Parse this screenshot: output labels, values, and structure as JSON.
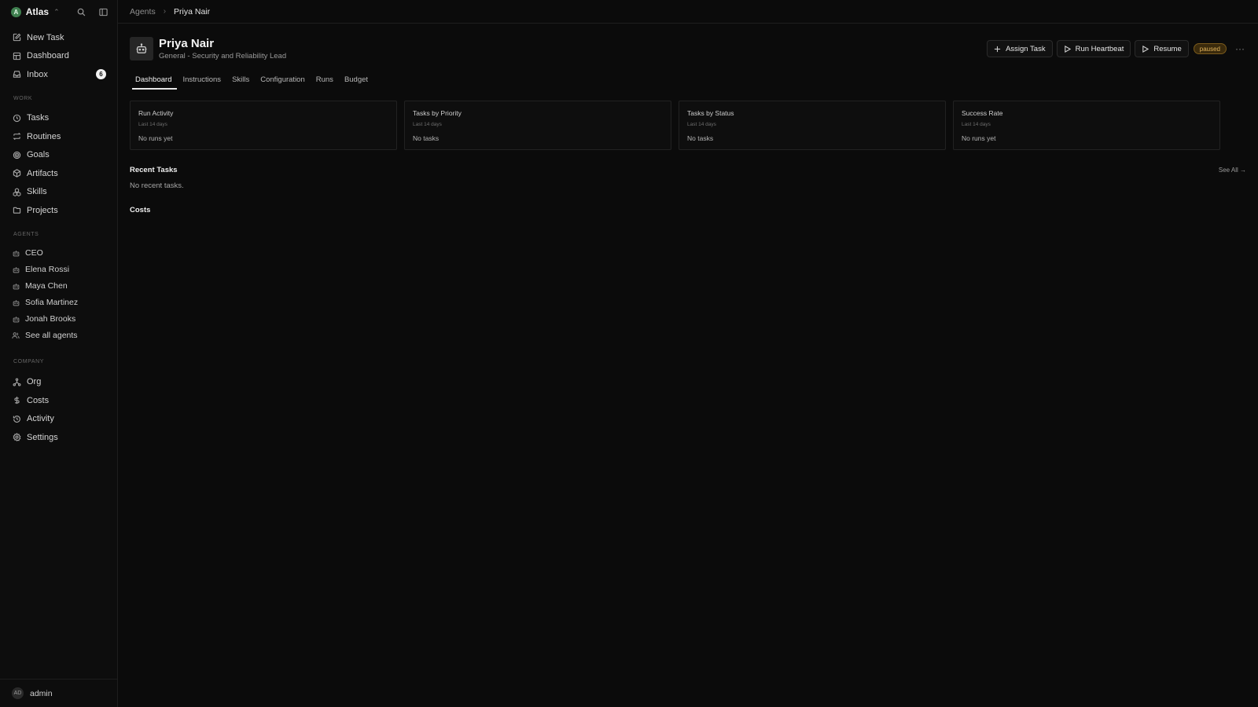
{
  "workspace": {
    "logo_letter": "A",
    "name": "Atlas"
  },
  "sidebar": {
    "primary": [
      {
        "label": "New Task",
        "icon": "pencil-square-icon"
      },
      {
        "label": "Dashboard",
        "icon": "dashboard-icon"
      },
      {
        "label": "Inbox",
        "icon": "inbox-icon",
        "badge": "6"
      }
    ],
    "work_label": "WORK",
    "work": [
      {
        "label": "Tasks",
        "icon": "circle-check-icon"
      },
      {
        "label": "Routines",
        "icon": "repeat-icon"
      },
      {
        "label": "Goals",
        "icon": "target-icon"
      },
      {
        "label": "Artifacts",
        "icon": "box-icon"
      },
      {
        "label": "Skills",
        "icon": "boxes-icon"
      },
      {
        "label": "Projects",
        "icon": "folder-icon"
      }
    ],
    "agents_label": "AGENTS",
    "agents": [
      "CEO",
      "Elena Rossi",
      "Maya Chen",
      "Sofia Martinez",
      "Jonah Brooks"
    ],
    "see_all_agents": "See all agents",
    "company_label": "COMPANY",
    "company": [
      {
        "label": "Org",
        "icon": "org-icon"
      },
      {
        "label": "Costs",
        "icon": "dollar-icon"
      },
      {
        "label": "Activity",
        "icon": "history-icon"
      },
      {
        "label": "Settings",
        "icon": "gear-icon"
      }
    ],
    "footer": {
      "initials": "AD",
      "name": "admin"
    }
  },
  "breadcrumb": {
    "parent": "Agents",
    "current": "Priya Nair"
  },
  "agent": {
    "name": "Priya Nair",
    "subtitle": "General - Security and Reliability Lead",
    "status": "paused"
  },
  "actions": {
    "assign": "Assign Task",
    "heartbeat": "Run Heartbeat",
    "resume": "Resume",
    "more": "···"
  },
  "tabs": [
    "Dashboard",
    "Instructions",
    "Skills",
    "Configuration",
    "Runs",
    "Budget"
  ],
  "cards": [
    {
      "title": "Run Activity",
      "sub": "Last 14 days",
      "empty": "No runs yet"
    },
    {
      "title": "Tasks by Priority",
      "sub": "Last 14 days",
      "empty": "No tasks"
    },
    {
      "title": "Tasks by Status",
      "sub": "Last 14 days",
      "empty": "No tasks"
    },
    {
      "title": "Success Rate",
      "sub": "Last 14 days",
      "empty": "No runs yet"
    }
  ],
  "recent": {
    "title": "Recent Tasks",
    "see_all": "See All →",
    "empty": "No recent tasks."
  },
  "costs": {
    "title": "Costs"
  },
  "colors": {
    "background": "#0b0b0b",
    "status_paused": "#e0b25a",
    "workspace_logo": "#3f7f4f"
  }
}
